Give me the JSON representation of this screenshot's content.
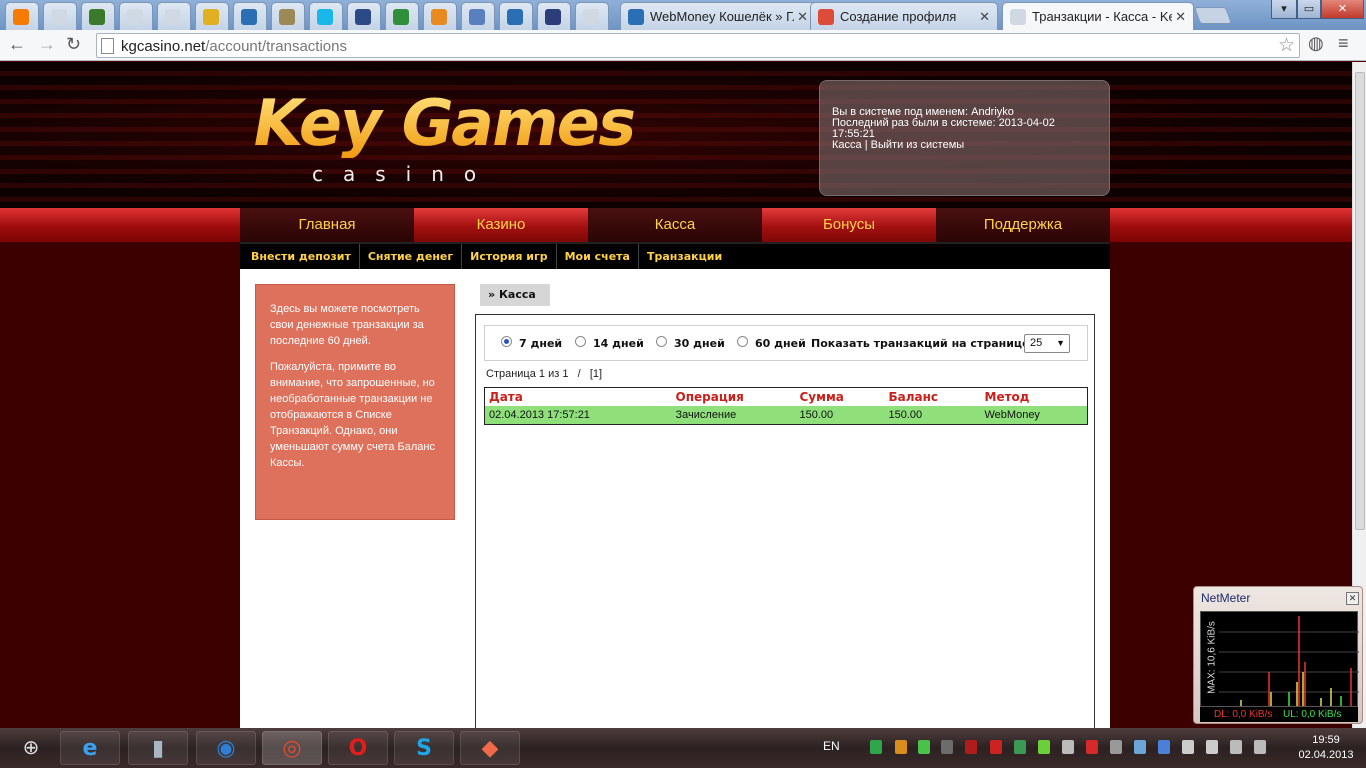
{
  "browser": {
    "tabs": [
      {
        "title": "",
        "icon": "blogger-icon",
        "color": "#f57c00"
      },
      {
        "title": "",
        "icon": "page-icon",
        "color": "#cfd8e3"
      },
      {
        "title": "",
        "icon": "rss-icon",
        "color": "#3b7a2a"
      },
      {
        "title": "",
        "icon": "page-icon",
        "color": "#cfd8e3"
      },
      {
        "title": "",
        "icon": "page-icon",
        "color": "#cfd8e3"
      },
      {
        "title": "",
        "icon": "coin-icon",
        "color": "#e0b020"
      },
      {
        "title": "",
        "icon": "target-icon",
        "color": "#2a6fb3"
      },
      {
        "title": "",
        "icon": "v-icon",
        "color": "#9b8a56"
      },
      {
        "title": "",
        "icon": "vimeo-icon",
        "color": "#1ab7ea"
      },
      {
        "title": "",
        "icon": "pacman-icon",
        "color": "#2c4a86"
      },
      {
        "title": "",
        "icon": "dollar-icon",
        "color": "#2f8f3a"
      },
      {
        "title": "",
        "icon": "orange-icon",
        "color": "#e88a20"
      },
      {
        "title": "",
        "icon": "at-icon",
        "color": "#5a7fbf"
      },
      {
        "title": "",
        "icon": "globe-icon",
        "color": "#2a6fb3"
      },
      {
        "title": "",
        "icon": "tinyurl-icon",
        "color": "#2c3e7a"
      },
      {
        "title": "",
        "icon": "page-icon",
        "color": "#cfd8e3"
      },
      {
        "title": "WebMoney Кошелёк » Гл",
        "icon": "globe-icon",
        "color": "#2a6fb3"
      },
      {
        "title": "Создание профиля",
        "icon": "gplus-icon",
        "color": "#dd4b39"
      },
      {
        "title": "Транзакции - Касса - Key",
        "icon": "page-icon",
        "color": "#cfd8e3"
      }
    ],
    "url_host": "kgcasino.net",
    "url_path": "/account/transactions"
  },
  "header": {
    "logo_main": "Key Games",
    "logo_sub": "casino",
    "login_line1": "Вы в системе под именем: Andriyko",
    "login_line2": "Последний раз были в системе: 2013-04-02 17:55:21",
    "link_kassa": "Касса",
    "separator": " | ",
    "link_logout": "Выйти из системы"
  },
  "main_nav": [
    "Главная",
    "Казино",
    "Касса",
    "Бонусы",
    "Поддержка"
  ],
  "sub_nav": [
    "Внести депозит",
    "Снятие денег",
    "История игр",
    "Мои счета",
    "Транзакции"
  ],
  "info": {
    "p1": "Здесь вы можете посмотреть свои денежные транзакции за последние 60 дней.",
    "p2": "Пожалуйста, примите во внимание, что запрошенные, но необработанные транзакции не отображаются в Списке Транзакций. Однако, они уменьшают сумму счета Баланс Кассы."
  },
  "breadcrumb": "Касса",
  "filters": {
    "options": [
      "7 дней",
      "14 дней",
      "30 дней",
      "60 дней"
    ],
    "selected": "7 дней",
    "per_page_label": "Показать транзакций на странице:",
    "per_page_value": "25"
  },
  "pagination": {
    "text": "Страница 1 из 1",
    "separator": "/",
    "current": "[1]"
  },
  "table": {
    "columns": [
      "Дата",
      "Операция",
      "Сумма",
      "Баланс",
      "Метод"
    ],
    "rows": [
      [
        "02.04.2013 17:57:21",
        "Зачисление",
        "150.00",
        "150.00",
        "WebMoney"
      ]
    ]
  },
  "netmeter": {
    "title": "NetMeter",
    "max": "MAX: 10,6 KiB/s",
    "dl": "DL: 0,0 KiB/s",
    "ul": "UL: 0,0 KiB/s"
  },
  "taskbar": {
    "lang": "EN",
    "time": "19:59",
    "date": "02.04.2013"
  }
}
